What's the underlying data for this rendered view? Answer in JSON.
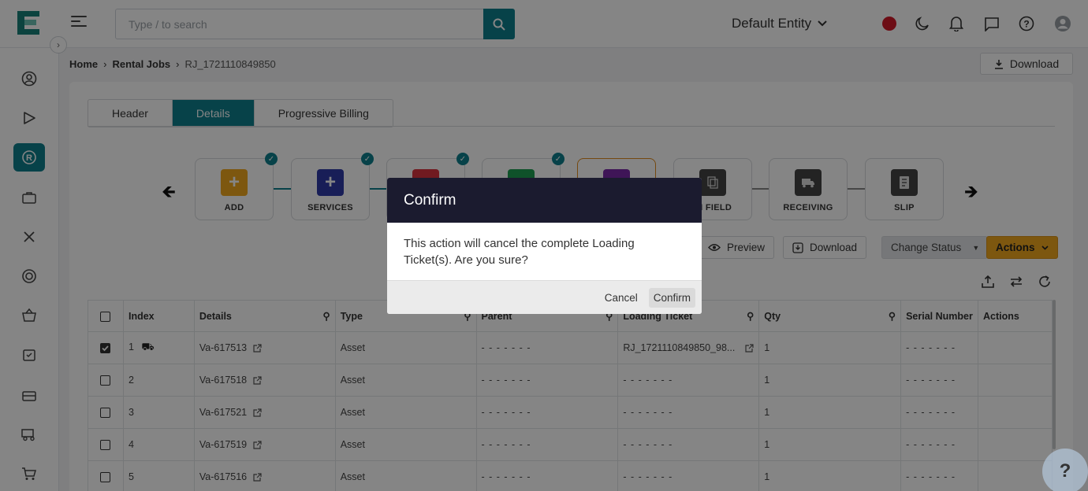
{
  "header": {
    "search_placeholder": "Type / to search",
    "entity": "Default Entity"
  },
  "breadcrumb": {
    "home": "Home",
    "sep": "›",
    "section": "Rental Jobs",
    "current": "RJ_1721110849850"
  },
  "download_top": "Download",
  "tabs": [
    "Header",
    "Details",
    "Progressive Billing"
  ],
  "steps": [
    {
      "label": "ADD",
      "color": "#f0a81e",
      "glyph": "+"
    },
    {
      "label": "SERVICES",
      "color": "#2e3aa8",
      "glyph": "+"
    },
    {
      "label": "",
      "color": "#d9333f",
      "glyph": ""
    },
    {
      "label": "",
      "color": "#1e9e52",
      "glyph": ""
    },
    {
      "label": "",
      "color": "#7a2aa8",
      "glyph": ""
    },
    {
      "label": "IN FIELD",
      "color": "#444",
      "glyph": ""
    },
    {
      "label": "RECEIVING",
      "color": "#444",
      "glyph": ""
    },
    {
      "label": "SLIP",
      "color": "#444",
      "glyph": ""
    }
  ],
  "toolbar": {
    "preview": "Preview",
    "download": "Download",
    "change_status": "Change Status",
    "actions": "Actions"
  },
  "table": {
    "columns": [
      "Index",
      "Details",
      "Type",
      "Parent",
      "Loading Ticket",
      "Qty",
      "Serial Number",
      "Actions"
    ],
    "rows": [
      {
        "index": "1",
        "details": "Va-617513",
        "type": "Asset",
        "parent": "- - - - - - -",
        "ticket": "RJ_1721110849850_98...",
        "qty": "1",
        "serial": "- - - - - - -",
        "checked": true
      },
      {
        "index": "2",
        "details": "Va-617518",
        "type": "Asset",
        "parent": "- - - - - - -",
        "ticket": "- - - - - - -",
        "qty": "1",
        "serial": "- - - - - - -",
        "checked": false
      },
      {
        "index": "3",
        "details": "Va-617521",
        "type": "Asset",
        "parent": "- - - - - - -",
        "ticket": "- - - - - - -",
        "qty": "1",
        "serial": "- - - - - - -",
        "checked": false
      },
      {
        "index": "4",
        "details": "Va-617519",
        "type": "Asset",
        "parent": "- - - - - - -",
        "ticket": "- - - - - - -",
        "qty": "1",
        "serial": "- - - - - - -",
        "checked": false
      },
      {
        "index": "5",
        "details": "Va-617516",
        "type": "Asset",
        "parent": "- - - - - - -",
        "ticket": "- - - - - - -",
        "qty": "1",
        "serial": "- - - - - - -",
        "checked": false
      }
    ]
  },
  "modal": {
    "title": "Confirm",
    "message": "This action will cancel the complete Loading Ticket(s). Are you sure?",
    "cancel": "Cancel",
    "confirm": "Confirm"
  },
  "help": "?",
  "colors": {
    "accent": "#0f7f8c",
    "modal_header": "#1b1b2f",
    "actions_button": "#f0a81e"
  }
}
